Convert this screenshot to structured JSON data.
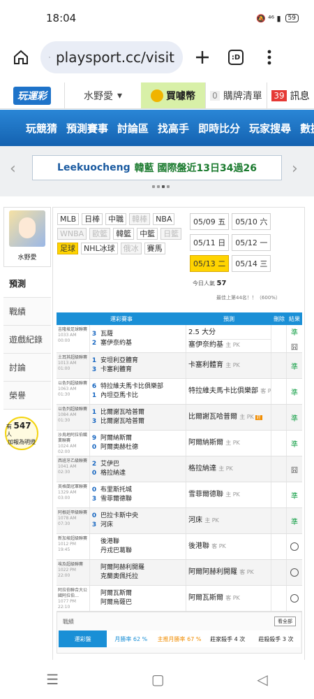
{
  "status": {
    "time": "18:04",
    "icons": "🔕 ⁴⁶ ▮",
    "battery": "59"
  },
  "browser": {
    "url": "playsport.cc/visit",
    "tab_count": ":D"
  },
  "site": {
    "logo": "玩運彩",
    "user": "水野愛",
    "buy": "買噱幣",
    "cart_count": "0",
    "cart": "購牌清單",
    "msg_count": "39",
    "msg": "訊息"
  },
  "nav": [
    "玩競猜",
    "預測賽事",
    "討論區",
    "找高手",
    "即時比分",
    "玩家搜尋",
    "數據"
  ],
  "ticker": {
    "name": "Leekuocheng",
    "text": "韓藍 國際盤近13日34過26"
  },
  "profile": {
    "name": "水野愛",
    "bulb_prefix": "有",
    "bulb_count": "547",
    "bulb_suffix": "人",
    "bulb_line2": "加報為明燈"
  },
  "side_menu": [
    "預測",
    "戰績",
    "遊戲紀錄",
    "討論",
    "榮譽"
  ],
  "leagues": [
    {
      "label": "MLB",
      "state": "normal"
    },
    {
      "label": "日棒",
      "state": "normal"
    },
    {
      "label": "中職",
      "state": "normal"
    },
    {
      "label": "韓棒",
      "state": "dim"
    },
    {
      "label": "NBA",
      "state": "normal"
    },
    {
      "label": "WNBA",
      "state": "dim"
    },
    {
      "label": "歐籃",
      "state": "dim"
    },
    {
      "label": "韓籃",
      "state": "normal"
    },
    {
      "label": "中籃",
      "state": "normal"
    },
    {
      "label": "日籃",
      "state": "dim"
    },
    {
      "label": "足球",
      "state": "on"
    },
    {
      "label": "NHL冰球",
      "state": "normal"
    },
    {
      "label": "俄冰",
      "state": "dim"
    },
    {
      "label": "賽馬",
      "state": "normal"
    }
  ],
  "dates": [
    {
      "label": "05/09 五",
      "on": false
    },
    {
      "label": "05/10 六",
      "on": false
    },
    {
      "label": "05/11 日",
      "on": false
    },
    {
      "label": "05/12 一",
      "on": false
    },
    {
      "label": "05/13 二",
      "on": true
    },
    {
      "label": "05/14 三",
      "on": false
    }
  ],
  "today": {
    "label": "今日人氣",
    "value": "57",
    "rank": "最佳上第44名！！（600%）"
  },
  "table": {
    "headers": [
      "運彩賽事",
      "預測",
      "刪除",
      "結果"
    ],
    "rows": [
      {
        "league": "吉隆坡足球聯賽",
        "code": "1033 AM 00:00",
        "s1": "3",
        "s2": "2",
        "t1": "瓦薩",
        "t2": "塞伊奈約基",
        "p1": "2.5 大分",
        "p1pk": "",
        "p2": "塞伊奈約基",
        "p2pk": "主 PK",
        "res": "準",
        "res2": "囧"
      },
      {
        "league": "土耳其超級聯賽",
        "code": "1013 AM 01:00",
        "s1": "1",
        "s2": "3",
        "t1": "安坦利亞體育",
        "t2": "卡塞利體育",
        "p1": "卡塞利體育",
        "p1pk": "主 PK",
        "res": "準"
      },
      {
        "league": "以色列超級聯賽",
        "code": "1063 AM 01:30",
        "s1": "6",
        "s2": "1",
        "t1": "特拉維夫馬卡比俱樂部",
        "t2": "內坦亞馬卡比",
        "p1": "特拉維夫馬卡比俱樂部",
        "p1pk": "客 PK",
        "res": "準"
      },
      {
        "league": "以色列超級聯賽",
        "code": "1084 AM 01:30",
        "s1": "1",
        "s2": "3",
        "t1": "比爾謝瓦哈普爾",
        "t2": "比爾謝瓦哈普爾",
        "p1": "比爾謝瓦哈普爾",
        "p1pk": "主 PK",
        "tag": "莊",
        "res": "準"
      },
      {
        "league": "沙烏地阿拉伯職業聯賽",
        "code": "1024 AM 02:00",
        "s1": "9",
        "s2": "0",
        "t1": "阿爾納斯爾",
        "t2": "阿爾奧赫杜德",
        "p1": "阿爾納斯爾",
        "p1pk": "主 PK",
        "res": "準"
      },
      {
        "league": "西班牙乙級聯賽",
        "code": "1041 AM 02:30",
        "s1": "2",
        "s2": "0",
        "t1": "艾伊巴",
        "t2": "格拉納達",
        "p1": "格拉納達",
        "p1pk": "主 PK",
        "res": "囧"
      },
      {
        "league": "英格蘭冠軍聯賽",
        "code": "1329 AM 03:00",
        "s1": "0",
        "s2": "3",
        "t1": "布里斯托城",
        "t2": "雪菲爾德聯",
        "p1": "雪菲爾德聯",
        "p1pk": "主 PK",
        "res": "準"
      },
      {
        "league": "阿根廷甲級聯賽",
        "code": "1078 AM 07:30",
        "s1": "0",
        "s2": "3",
        "t1": "巴拉卡斯中央",
        "t2": "河床",
        "p1": "河床",
        "p1pk": "主 PK",
        "res": "準"
      },
      {
        "league": "新加坡超級聯賽",
        "code": "1012 PM 19:45",
        "s1": "",
        "s2": "",
        "t1": "後港聯",
        "t2": "丹戎巴葛聯",
        "p1": "後港聯",
        "p1pk": "客 PK",
        "res": "○"
      },
      {
        "league": "埃及超級聯賽",
        "code": "1022 PM 22:00",
        "s1": "",
        "s2": "",
        "t1": "阿爾阿赫利開羅",
        "t2": "克蘭奧佩托拉",
        "p1": "阿爾阿赫利開羅",
        "p1pk": "客 PK",
        "res": "○"
      },
      {
        "league": "阿拉伯聯合大公國阿拉伯…",
        "code": "1077 PM 22:10",
        "s1": "",
        "s2": "",
        "t1": "阿爾瓦斯爾",
        "t2": "阿爾烏薩巴",
        "p1": "阿爾瓦斯爾",
        "p1pk": "客 PK",
        "res": "○"
      }
    ]
  },
  "stats": {
    "title": "戰績",
    "more": "看全部",
    "tab": "運彩盤",
    "items": [
      "月勝率 62 %",
      "主推月勝率 67 %",
      "莊家殺手 4 次",
      "莊殺殺手 3 次"
    ]
  }
}
